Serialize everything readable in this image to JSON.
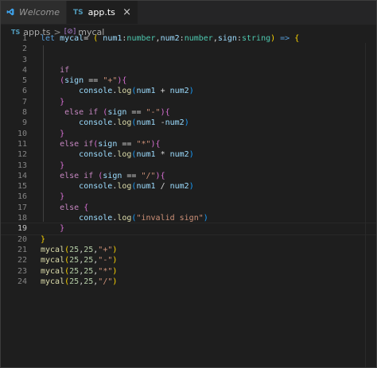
{
  "tabs": [
    {
      "label": "Welcome",
      "icon": "vscode-logo-icon",
      "active": false
    },
    {
      "label": "app.ts",
      "icon_text": "TS",
      "close": "×",
      "active": true
    }
  ],
  "breadcrumb": {
    "file_icon": "TS",
    "file": "app.ts",
    "separator": ">",
    "symbol_icon": "[⊘]",
    "symbol": "mycal"
  },
  "editor": {
    "current_line": 19,
    "lines": [
      {
        "n": "1",
        "tokens": [
          {
            "t": "let ",
            "c": "kw"
          },
          {
            "t": "mycal",
            "c": "var"
          },
          {
            "t": "= ",
            "c": "plain"
          },
          {
            "t": "( ",
            "c": "b1"
          },
          {
            "t": "num1",
            "c": "var"
          },
          {
            "t": ":",
            "c": "plain"
          },
          {
            "t": "number",
            "c": "type"
          },
          {
            "t": ",",
            "c": "plain"
          },
          {
            "t": "num2",
            "c": "var"
          },
          {
            "t": ":",
            "c": "plain"
          },
          {
            "t": "number",
            "c": "type"
          },
          {
            "t": ",",
            "c": "plain"
          },
          {
            "t": "sign",
            "c": "var"
          },
          {
            "t": ":",
            "c": "plain"
          },
          {
            "t": "string",
            "c": "type"
          },
          {
            "t": ") ",
            "c": "b1"
          },
          {
            "t": "=> ",
            "c": "kw"
          },
          {
            "t": "{",
            "c": "b1"
          }
        ]
      },
      {
        "n": "2",
        "tokens": []
      },
      {
        "n": "3",
        "tokens": []
      },
      {
        "n": "4",
        "tokens": [
          {
            "t": "    if",
            "c": "ctl"
          }
        ]
      },
      {
        "n": "5",
        "tokens": [
          {
            "t": "    ",
            "c": "plain"
          },
          {
            "t": "(",
            "c": "b2"
          },
          {
            "t": "sign",
            "c": "var"
          },
          {
            "t": " == ",
            "c": "plain"
          },
          {
            "t": "\"+\"",
            "c": "str"
          },
          {
            "t": ")",
            "c": "b2"
          },
          {
            "t": "{",
            "c": "b2"
          }
        ]
      },
      {
        "n": "6",
        "tokens": [
          {
            "t": "        ",
            "c": "plain"
          },
          {
            "t": "console",
            "c": "var"
          },
          {
            "t": ".",
            "c": "plain"
          },
          {
            "t": "log",
            "c": "fn"
          },
          {
            "t": "(",
            "c": "b3"
          },
          {
            "t": "num1",
            "c": "var"
          },
          {
            "t": " + ",
            "c": "plain"
          },
          {
            "t": "num2",
            "c": "var"
          },
          {
            "t": ")",
            "c": "b3"
          }
        ]
      },
      {
        "n": "7",
        "tokens": [
          {
            "t": "    ",
            "c": "plain"
          },
          {
            "t": "}",
            "c": "b2"
          }
        ]
      },
      {
        "n": "8",
        "tokens": [
          {
            "t": "     else if ",
            "c": "ctl"
          },
          {
            "t": "(",
            "c": "b2"
          },
          {
            "t": "sign",
            "c": "var"
          },
          {
            "t": " == ",
            "c": "plain"
          },
          {
            "t": "\"-\"",
            "c": "str"
          },
          {
            "t": ")",
            "c": "b2"
          },
          {
            "t": "{",
            "c": "b2"
          }
        ]
      },
      {
        "n": "9",
        "tokens": [
          {
            "t": "        ",
            "c": "plain"
          },
          {
            "t": "console",
            "c": "var"
          },
          {
            "t": ".",
            "c": "plain"
          },
          {
            "t": "log",
            "c": "fn"
          },
          {
            "t": "(",
            "c": "b3"
          },
          {
            "t": "num1",
            "c": "var"
          },
          {
            "t": " -",
            "c": "plain"
          },
          {
            "t": "num2",
            "c": "var"
          },
          {
            "t": ")",
            "c": "b3"
          }
        ]
      },
      {
        "n": "10",
        "tokens": [
          {
            "t": "    ",
            "c": "plain"
          },
          {
            "t": "}",
            "c": "b2"
          }
        ]
      },
      {
        "n": "11",
        "tokens": [
          {
            "t": "    else if",
            "c": "ctl"
          },
          {
            "t": "(",
            "c": "b2"
          },
          {
            "t": "sign",
            "c": "var"
          },
          {
            "t": " == ",
            "c": "plain"
          },
          {
            "t": "\"*\"",
            "c": "str"
          },
          {
            "t": ")",
            "c": "b2"
          },
          {
            "t": "{",
            "c": "b2"
          }
        ]
      },
      {
        "n": "12",
        "tokens": [
          {
            "t": "        ",
            "c": "plain"
          },
          {
            "t": "console",
            "c": "var"
          },
          {
            "t": ".",
            "c": "plain"
          },
          {
            "t": "log",
            "c": "fn"
          },
          {
            "t": "(",
            "c": "b3"
          },
          {
            "t": "num1",
            "c": "var"
          },
          {
            "t": " * ",
            "c": "plain"
          },
          {
            "t": "num2",
            "c": "var"
          },
          {
            "t": ")",
            "c": "b3"
          }
        ]
      },
      {
        "n": "13",
        "tokens": [
          {
            "t": "    ",
            "c": "plain"
          },
          {
            "t": "}",
            "c": "b2"
          }
        ]
      },
      {
        "n": "14",
        "tokens": [
          {
            "t": "    else if ",
            "c": "ctl"
          },
          {
            "t": "(",
            "c": "b2"
          },
          {
            "t": "sign",
            "c": "var"
          },
          {
            "t": " == ",
            "c": "plain"
          },
          {
            "t": "\"/\"",
            "c": "str"
          },
          {
            "t": ")",
            "c": "b2"
          },
          {
            "t": "{",
            "c": "b2"
          }
        ]
      },
      {
        "n": "15",
        "tokens": [
          {
            "t": "        ",
            "c": "plain"
          },
          {
            "t": "console",
            "c": "var"
          },
          {
            "t": ".",
            "c": "plain"
          },
          {
            "t": "log",
            "c": "fn"
          },
          {
            "t": "(",
            "c": "b3"
          },
          {
            "t": "num1",
            "c": "var"
          },
          {
            "t": " / ",
            "c": "plain"
          },
          {
            "t": "num2",
            "c": "var"
          },
          {
            "t": ")",
            "c": "b3"
          }
        ]
      },
      {
        "n": "16",
        "tokens": [
          {
            "t": "    ",
            "c": "plain"
          },
          {
            "t": "}",
            "c": "b2"
          }
        ]
      },
      {
        "n": "17",
        "tokens": [
          {
            "t": "    else ",
            "c": "ctl"
          },
          {
            "t": "{",
            "c": "b2"
          }
        ]
      },
      {
        "n": "18",
        "tokens": [
          {
            "t": "        ",
            "c": "plain"
          },
          {
            "t": "console",
            "c": "var"
          },
          {
            "t": ".",
            "c": "plain"
          },
          {
            "t": "log",
            "c": "fn"
          },
          {
            "t": "(",
            "c": "b3"
          },
          {
            "t": "\"invalid sign\"",
            "c": "str"
          },
          {
            "t": ")",
            "c": "b3"
          }
        ]
      },
      {
        "n": "19",
        "tokens": [
          {
            "t": "    ",
            "c": "plain"
          },
          {
            "t": "}",
            "c": "b2"
          }
        ]
      },
      {
        "n": "20",
        "tokens": [
          {
            "t": "}",
            "c": "b1"
          }
        ]
      },
      {
        "n": "21",
        "tokens": [
          {
            "t": "mycal",
            "c": "fn"
          },
          {
            "t": "(",
            "c": "b1"
          },
          {
            "t": "25",
            "c": "num"
          },
          {
            "t": ",",
            "c": "plain"
          },
          {
            "t": "25",
            "c": "num"
          },
          {
            "t": ",",
            "c": "plain"
          },
          {
            "t": "\"+\"",
            "c": "str"
          },
          {
            "t": ")",
            "c": "b1"
          }
        ]
      },
      {
        "n": "22",
        "tokens": [
          {
            "t": "mycal",
            "c": "fn"
          },
          {
            "t": "(",
            "c": "b1"
          },
          {
            "t": "25",
            "c": "num"
          },
          {
            "t": ",",
            "c": "plain"
          },
          {
            "t": "25",
            "c": "num"
          },
          {
            "t": ",",
            "c": "plain"
          },
          {
            "t": "\"-\"",
            "c": "str"
          },
          {
            "t": ")",
            "c": "b1"
          }
        ]
      },
      {
        "n": "23",
        "tokens": [
          {
            "t": "mycal",
            "c": "fn"
          },
          {
            "t": "(",
            "c": "b1"
          },
          {
            "t": "25",
            "c": "num"
          },
          {
            "t": ",",
            "c": "plain"
          },
          {
            "t": "25",
            "c": "num"
          },
          {
            "t": ",",
            "c": "plain"
          },
          {
            "t": "\"*\"",
            "c": "str"
          },
          {
            "t": ")",
            "c": "b1"
          }
        ]
      },
      {
        "n": "24",
        "tokens": [
          {
            "t": "mycal",
            "c": "fn"
          },
          {
            "t": "(",
            "c": "b1"
          },
          {
            "t": "25",
            "c": "num"
          },
          {
            "t": ",",
            "c": "plain"
          },
          {
            "t": "25",
            "c": "num"
          },
          {
            "t": ",",
            "c": "plain"
          },
          {
            "t": "\"/\"",
            "c": "str"
          },
          {
            "t": ")",
            "c": "b1"
          }
        ]
      }
    ]
  }
}
